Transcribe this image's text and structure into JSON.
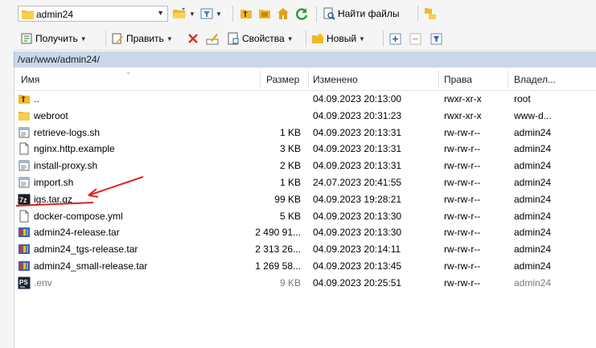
{
  "toolbar1": {
    "path_combo_value": "admin24",
    "find_files_label": "Найти файлы"
  },
  "toolbar2": {
    "download_label": "Получить",
    "edit_label": "Править",
    "properties_label": "Свойства",
    "new_label": "Новый"
  },
  "path": "/var/www/admin24/",
  "columns": {
    "name": "Имя",
    "size": "Размер",
    "modified": "Изменено",
    "rights": "Права",
    "owner": "Владел..."
  },
  "files": [
    {
      "name": "..",
      "size": "",
      "modified": "04.09.2023 20:13:00",
      "rights": "rwxr-xr-x",
      "owner": "root",
      "icon": "parent-folder-icon"
    },
    {
      "name": "webroot",
      "size": "",
      "modified": "04.09.2023 20:31:23",
      "rights": "rwxr-xr-x",
      "owner": "www-d...",
      "icon": "folder-icon"
    },
    {
      "name": "retrieve-logs.sh",
      "size": "1 KB",
      "modified": "04.09.2023 20:13:31",
      "rights": "rw-rw-r--",
      "owner": "admin24",
      "icon": "script-icon"
    },
    {
      "name": "nginx.http.example",
      "size": "3 KB",
      "modified": "04.09.2023 20:13:31",
      "rights": "rw-rw-r--",
      "owner": "admin24",
      "icon": "file-icon"
    },
    {
      "name": "install-proxy.sh",
      "size": "2 KB",
      "modified": "04.09.2023 20:13:31",
      "rights": "rw-rw-r--",
      "owner": "admin24",
      "icon": "script-icon"
    },
    {
      "name": "import.sh",
      "size": "1 KB",
      "modified": "24.07.2023 20:41:55",
      "rights": "rw-rw-r--",
      "owner": "admin24",
      "icon": "script-icon"
    },
    {
      "name": "igs.tar.gz",
      "size": "99 KB",
      "modified": "04.09.2023 19:28:21",
      "rights": "rw-rw-r--",
      "owner": "admin24",
      "icon": "7zip-icon"
    },
    {
      "name": "docker-compose.yml",
      "size": "5 KB",
      "modified": "04.09.2023 20:13:30",
      "rights": "rw-rw-r--",
      "owner": "admin24",
      "icon": "file-icon"
    },
    {
      "name": "admin24-release.tar",
      "size": "2 490 91...",
      "modified": "04.09.2023 20:13:30",
      "rights": "rw-rw-r--",
      "owner": "admin24",
      "icon": "archive-icon"
    },
    {
      "name": "admin24_tgs-release.tar",
      "size": "2 313 26...",
      "modified": "04.09.2023 20:14:11",
      "rights": "rw-rw-r--",
      "owner": "admin24",
      "icon": "archive-icon"
    },
    {
      "name": "admin24_small-release.tar",
      "size": "1 269 58...",
      "modified": "04.09.2023 20:13:45",
      "rights": "rw-rw-r--",
      "owner": "admin24",
      "icon": "archive-icon"
    },
    {
      "name": ".env",
      "size": "9 KB",
      "modified": "04.09.2023 20:25:51",
      "rights": "rw-rw-r--",
      "owner": "admin24",
      "icon": "powershell-icon",
      "dimmed": true
    }
  ],
  "colors": {
    "pathbar": "#c9d8ea",
    "annotation": "#e02020"
  }
}
